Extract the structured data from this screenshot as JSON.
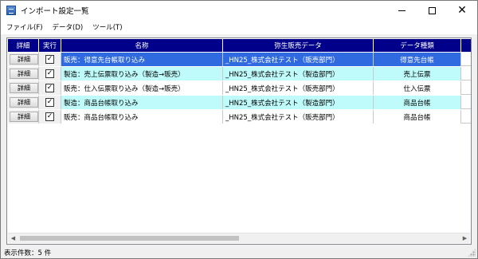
{
  "window": {
    "title": "インポート設定一覧",
    "icon": "app-window-icon"
  },
  "menu": [
    "ファイル(F)",
    "データ(D)",
    "ツール(T)"
  ],
  "grid": {
    "columns": [
      "詳細",
      "実行",
      "名称",
      "弥生販売データ",
      "データ種類"
    ],
    "detail_button_label": "詳細",
    "rows": [
      {
        "checked": true,
        "name": "販売：得意先台帳取り込み",
        "source": "_HN25_株式会社テスト（販売部門）",
        "type": "得意先台帳",
        "state": "selected"
      },
      {
        "checked": true,
        "name": "製造：売上伝票取り込み（製造→販売）",
        "source": "_HN25_株式会社テスト（製造部門）",
        "type": "売上伝票",
        "state": "cyan"
      },
      {
        "checked": true,
        "name": "販売：仕入伝票取り込み（製造→販売）",
        "source": "_HN25_株式会社テスト（販売部門）",
        "type": "仕入伝票",
        "state": "white"
      },
      {
        "checked": true,
        "name": "製造：商品台帳取り込み",
        "source": "_HN25_株式会社テスト（製造部門）",
        "type": "商品台帳",
        "state": "cyan"
      },
      {
        "checked": true,
        "name": "販売：商品台帳取り込み",
        "source": "_HN25_株式会社テスト（販売部門）",
        "type": "商品台帳",
        "state": "white"
      }
    ]
  },
  "status": {
    "text": "表示件数：5 件"
  },
  "colors": {
    "header_bg": "#00008b",
    "selected_bg": "#2f6ae0",
    "alt_row_bg": "#c0fbfb"
  }
}
